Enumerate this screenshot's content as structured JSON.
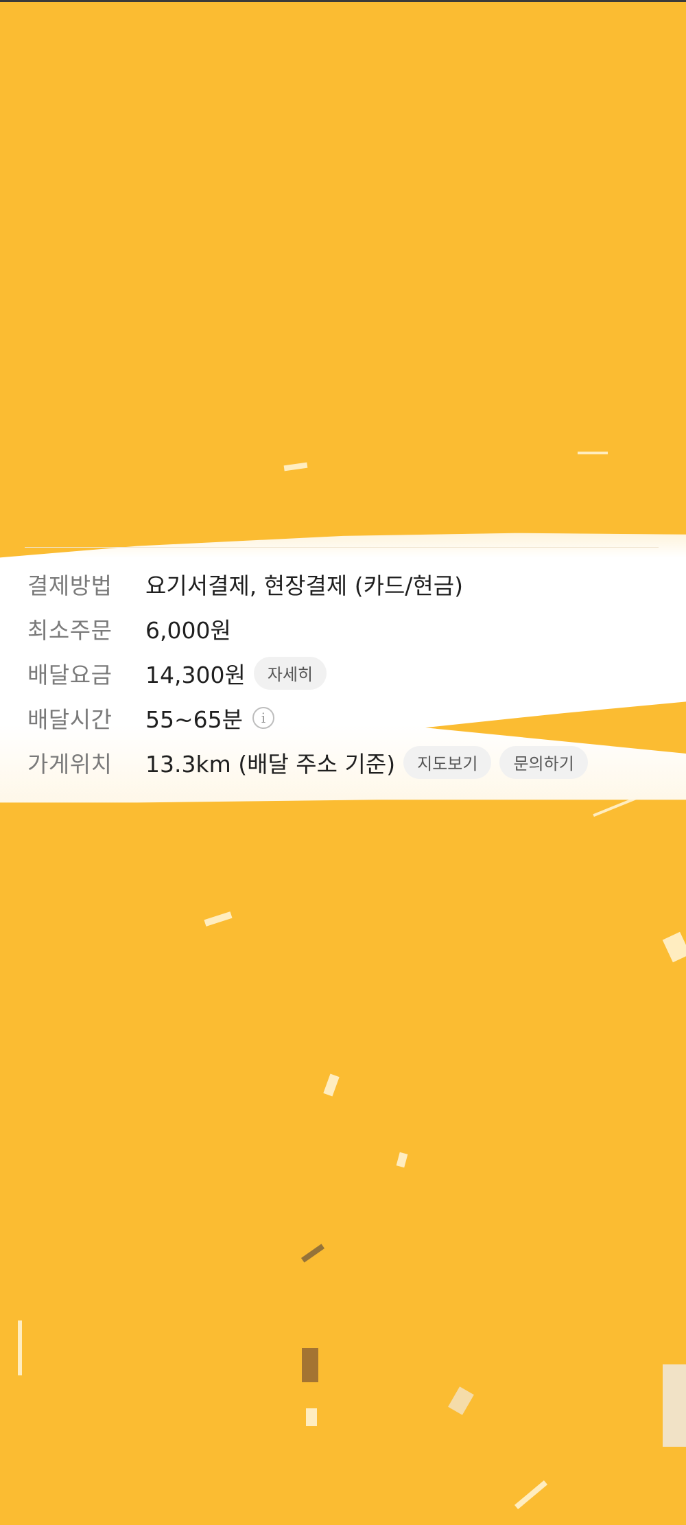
{
  "store_info": {
    "rows": [
      {
        "label": "결제방법",
        "value": "요기서결제, 현장결제 (카드/현금)"
      },
      {
        "label": "최소주문",
        "value": "6,000원"
      },
      {
        "label": "배달요금",
        "value": "14,300원",
        "button": "자세히"
      },
      {
        "label": "배달시간",
        "value": "55~65분",
        "icon": "info-icon"
      },
      {
        "label": "가게위치",
        "value": "13.3km (배달 주소 기준)",
        "buttons": [
          "지도보기",
          "문의하기"
        ]
      }
    ]
  },
  "colors": {
    "background": "#fbbc32",
    "panel": "#ffffff",
    "label": "#7a7a7a",
    "value": "#1f1f1f"
  }
}
